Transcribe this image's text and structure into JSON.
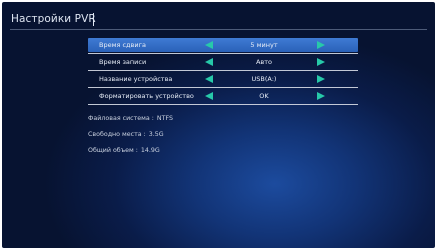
{
  "header": {
    "title": "Настройки PVR"
  },
  "settings": [
    {
      "label": "Время сдвига",
      "value": "5 минут",
      "selected": true
    },
    {
      "label": "Время записи",
      "value": "Авто",
      "selected": false
    },
    {
      "label": "Название устройства",
      "value": "USB(A:)",
      "selected": false
    },
    {
      "label": "Форматировать устройство",
      "value": "OK",
      "selected": false
    }
  ],
  "info": [
    {
      "key": "Файловая система :",
      "value": "NTFS"
    },
    {
      "key": "Свободно места :",
      "value": "3.5G"
    },
    {
      "key": "Общий объем :",
      "value": "14.9G"
    }
  ],
  "colors": {
    "accent": "#27c9a9",
    "selected_row": "#2f67c0",
    "background": "#0a1c49"
  },
  "icons": {
    "left": "arrow-left-icon",
    "right": "arrow-right-icon"
  }
}
